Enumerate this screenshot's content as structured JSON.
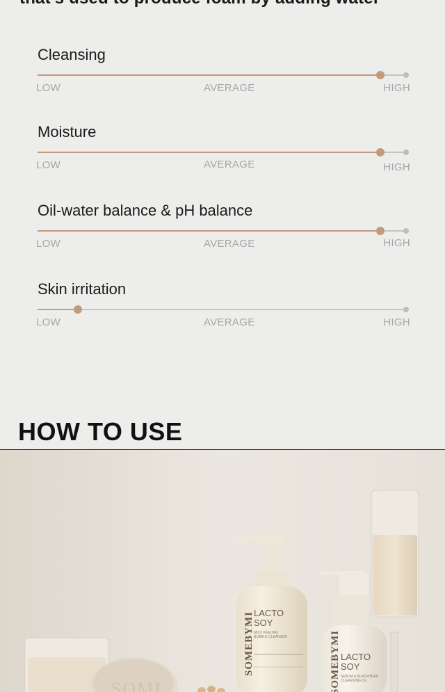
{
  "intro": {
    "text": "that's used to produce foam by adding water"
  },
  "scale": {
    "low": "LOW",
    "average": "AVERAGE",
    "high": "HIGH"
  },
  "ratings": [
    {
      "label": "Cleansing",
      "level": 0.93
    },
    {
      "label": "Moisture",
      "level": 0.93
    },
    {
      "label": "Oil-water balance & pH balance",
      "level": 0.93
    },
    {
      "label": "Skin irritation",
      "level": 0.11
    }
  ],
  "how_to_use": {
    "title": "HOW TO USE"
  },
  "product_photo": {
    "bottle_large": {
      "brand": "SOMEBYMI",
      "line1": "LACTO",
      "line2": "SOY",
      "desc1": "MILD PEELING",
      "desc2": "BUBBLE CLEANSER"
    },
    "bottle_small": {
      "brand": "SOMEBYMI",
      "line1": "LACTO",
      "line2": "SOY",
      "desc1": "SEBUM & BLACKHEAD",
      "desc2": "CLEANSING OIL"
    },
    "jar_text": "SOMI"
  },
  "colors": {
    "accent": "#c49a7c",
    "track": "#c4c4c4",
    "background": "#ededeb"
  }
}
